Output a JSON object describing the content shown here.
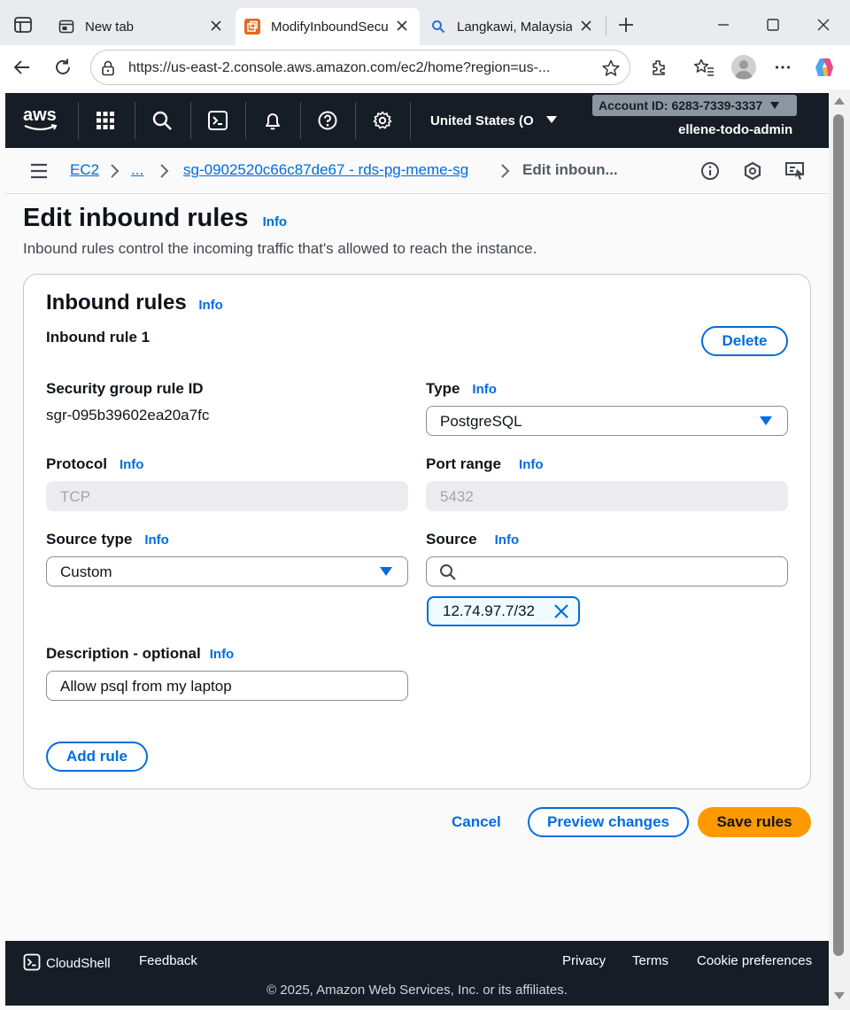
{
  "browser": {
    "tabs": [
      {
        "title": "New tab"
      },
      {
        "title": "ModifyInboundSecu"
      },
      {
        "title": "Langkawi, Malaysia"
      }
    ],
    "url": "https://us-east-2.console.aws.amazon.com/ec2/home?region=us-..."
  },
  "aws_header": {
    "logo": "aws",
    "region": "United States (O",
    "account": "Account ID: 6283-7339-3337",
    "username": "ellene-todo-admin"
  },
  "breadcrumb": {
    "ec2": "EC2",
    "ellipsis": "...",
    "sg": "sg-0902520c66c87de67 - rds-pg-meme-sg",
    "current": "Edit inboun..."
  },
  "page": {
    "title": "Edit inbound rules",
    "info": "Info",
    "description": "Inbound rules control the incoming traffic that's allowed to reach the instance."
  },
  "card": {
    "title": "Inbound rules",
    "rule_title": "Inbound rule 1",
    "delete_label": "Delete",
    "sg_rule_id_label": "Security group rule ID",
    "sg_rule_id": "sgr-095b39602ea20a7fc",
    "type_label": "Type",
    "type_value": "PostgreSQL",
    "protocol_label": "Protocol",
    "protocol_value": "TCP",
    "port_label": "Port range",
    "port_value": "5432",
    "source_type_label": "Source type",
    "source_type_value": "Custom",
    "source_label": "Source",
    "source_search": "",
    "source_token": "12.74.97.7/32",
    "desc_label": "Description - optional",
    "desc_value": "Allow psql from my laptop",
    "add_rule_label": "Add rule"
  },
  "actions": {
    "cancel": "Cancel",
    "preview": "Preview changes",
    "save": "Save rules"
  },
  "footer": {
    "cloudshell": "CloudShell",
    "feedback": "Feedback",
    "privacy": "Privacy",
    "terms": "Terms",
    "cookies": "Cookie preferences",
    "copyright": "© 2025, Amazon Web Services, Inc. or its affiliates."
  },
  "colors": {
    "link": "#006ce0",
    "primary_button": "#ff9900",
    "header_bg": "#161d26"
  }
}
